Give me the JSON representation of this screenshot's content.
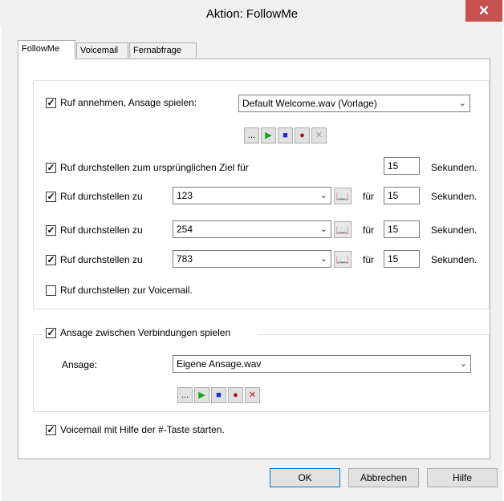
{
  "window": {
    "title": "Aktion: FollowMe",
    "close_glyph": "✕"
  },
  "tabs": [
    {
      "label": "FollowMe",
      "active": true
    },
    {
      "label": "Voicemail",
      "active": false
    },
    {
      "label": "Fernabfrage",
      "active": false
    }
  ],
  "section1": {
    "answer_call": {
      "checked": true,
      "label": "Ruf annehmen, Ansage spielen:",
      "select_value": "Default Welcome.wav (Vorlage)"
    },
    "controls": {
      "browse": "...",
      "play": "▶",
      "stop": "■",
      "record": "●",
      "delete": "✕"
    },
    "transfer_original": {
      "checked": true,
      "label": "Ruf durchstellen zum ursprünglichen Ziel für",
      "seconds": "15",
      "unit": "Sekunden."
    },
    "transfers": [
      {
        "checked": true,
        "label": "Ruf durchstellen zu",
        "number": "123",
        "fuer": "für",
        "seconds": "15",
        "unit": "Sekunden."
      },
      {
        "checked": true,
        "label": "Ruf durchstellen zu",
        "number": "254",
        "fuer": "für",
        "seconds": "15",
        "unit": "Sekunden."
      },
      {
        "checked": true,
        "label": "Ruf durchstellen zu",
        "number": "783",
        "fuer": "für",
        "seconds": "15",
        "unit": "Sekunden."
      }
    ],
    "voicemail_transfer": {
      "checked": false,
      "label": "Ruf durchstellen zur Voicemail."
    }
  },
  "section2": {
    "group_checkbox": {
      "checked": true,
      "label": "Ansage zwischen Verbindungen spielen"
    },
    "ansage_label": "Ansage:",
    "ansage_value": "Eigene Ansage.wav",
    "controls": {
      "browse": "...",
      "play": "▶",
      "stop": "■",
      "record": "●",
      "delete": "✕"
    }
  },
  "voicemail_hash": {
    "checked": true,
    "label": "Voicemail mit Hilfe der #-Taste starten."
  },
  "buttons": {
    "ok": "OK",
    "cancel": "Abbrechen",
    "help": "Hilfe"
  },
  "icons": {
    "dropdown": "chevron-down-icon",
    "phonebook": "book-icon",
    "check_mark": "✓"
  },
  "colors": {
    "play": "#18a418",
    "stop": "#1c2fd6",
    "record": "#b01010",
    "delete_active": "#c01010",
    "delete_disabled": "#9a9a9a",
    "close_bg": "#c75050"
  }
}
